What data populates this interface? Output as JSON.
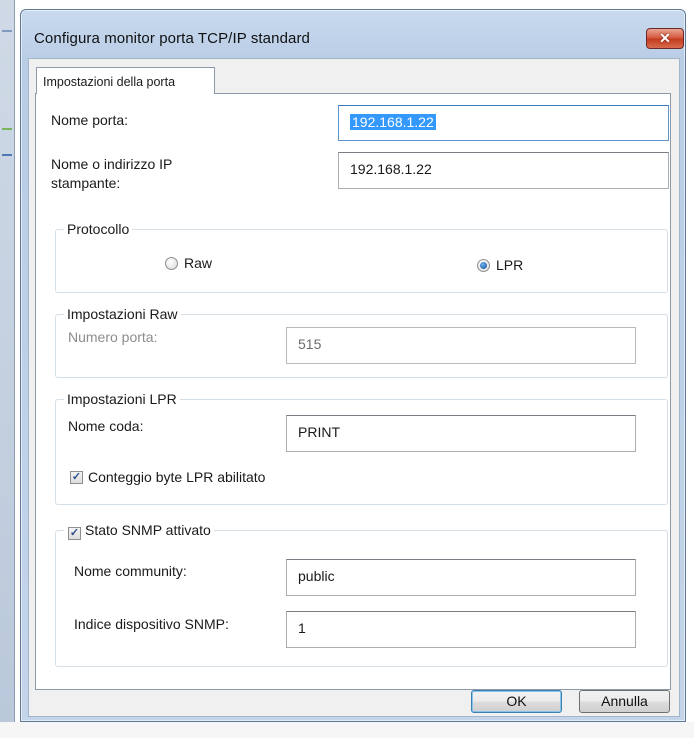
{
  "window": {
    "title": "Configura monitor porta TCP/IP standard",
    "close_glyph": "✕"
  },
  "tab": {
    "label": "Impostazioni della porta"
  },
  "port": {
    "name_label": "Nome porta:",
    "name_value": "192.168.1.22",
    "ip_label_line1": "Nome o indirizzo IP",
    "ip_label_line2": "stampante:",
    "ip_value": "192.168.1.22"
  },
  "protocol": {
    "legend": "Protocollo",
    "options": [
      {
        "label": "Raw",
        "selected": false
      },
      {
        "label": "LPR",
        "selected": true
      }
    ]
  },
  "raw_settings": {
    "legend": "Impostazioni Raw",
    "port_number_label": "Numero porta:",
    "port_number_value": "515",
    "enabled": false
  },
  "lpr_settings": {
    "legend": "Impostazioni LPR",
    "queue_name_label": "Nome coda:",
    "queue_name_value": "PRINT",
    "byte_count_label": "Conteggio byte LPR abilitato",
    "byte_count_checked": true
  },
  "snmp": {
    "enabled_label": "Stato SNMP attivato",
    "enabled_checked": true,
    "community_label": "Nome community:",
    "community_value": "public",
    "device_index_label": "Indice dispositivo SNMP:",
    "device_index_value": "1"
  },
  "buttons": {
    "ok": "OK",
    "cancel": "Annulla"
  },
  "check_glyph": "✓",
  "colors": {
    "title_bar": "#c9daee",
    "close_button": "#c23a1e",
    "selection": "#3399ff",
    "default_button_border": "#3c7fb1"
  }
}
